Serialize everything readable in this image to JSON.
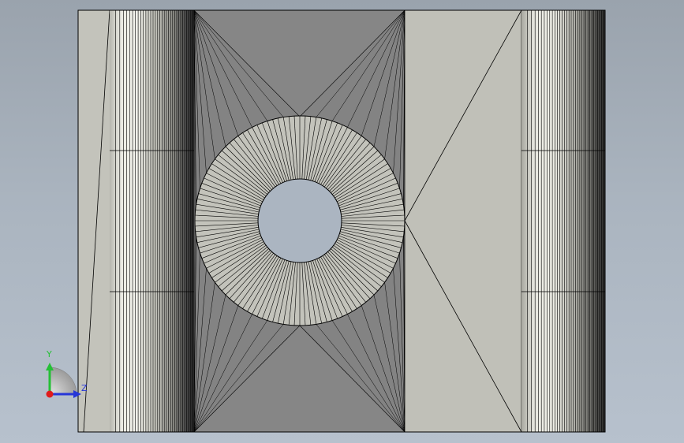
{
  "viewport": {
    "background_top": "#9aa3ad",
    "background_bottom": "#b7c1cd"
  },
  "model": {
    "face_color": "#c0c0b8",
    "dark_face_color": "#858585",
    "edge_color": "#000000",
    "roller_highlight": "#f1f1ea"
  },
  "triad": {
    "y_label": "Y",
    "z_label": "Z",
    "y_color": "#25c036",
    "z_color": "#2636d8",
    "x_color": "#e01b1b"
  }
}
